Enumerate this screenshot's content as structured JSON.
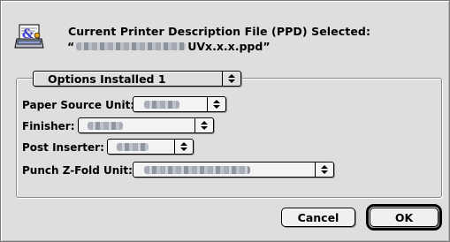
{
  "dialog": {
    "title": "Current Printer Description File (PPD) Selected:",
    "ppd_prefix": "“",
    "ppd_name": "UVx.x.x.ppd”",
    "icon": "printer-settings-icon"
  },
  "options_group": {
    "selected": "Options Installed 1",
    "fields": [
      {
        "label": "Paper Source Unit:"
      },
      {
        "label": "Finisher:"
      },
      {
        "label": "Post Inserter:"
      },
      {
        "label": "Punch Z-Fold Unit:"
      }
    ]
  },
  "buttons": {
    "cancel": "Cancel",
    "ok": "OK"
  }
}
